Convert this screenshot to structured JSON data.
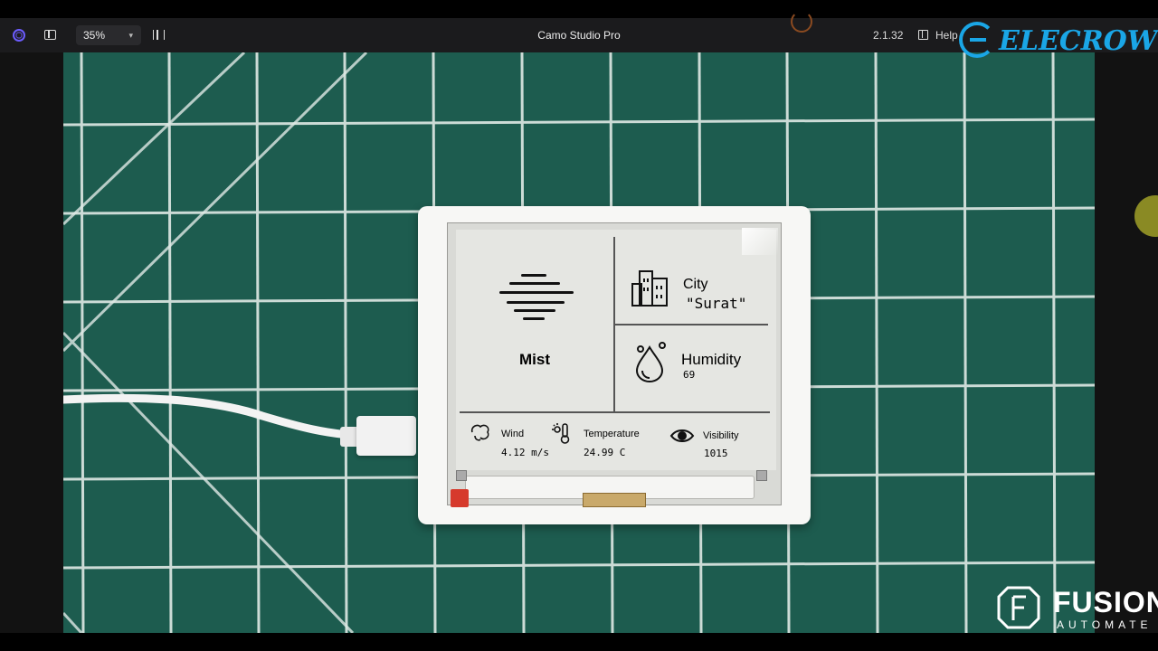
{
  "toolbar": {
    "zoom": "35%",
    "title": "Camo Studio Pro",
    "version": "2.1.32",
    "help": "Help"
  },
  "watermarks": {
    "brand_top": "ELECROW",
    "brand_bottom_name": "FUSION",
    "brand_bottom_sub": "AUTOMATE"
  },
  "epaper": {
    "condition": "Mist",
    "city_label": "City",
    "city_value": "\"Surat\"",
    "humidity_label": "Humidity",
    "humidity_value": "69",
    "wind_label": "Wind",
    "wind_value": "4.12 m/s",
    "temperature_label": "Temperature",
    "temperature_value": "24.99 C",
    "visibility_label": "Visibility",
    "visibility_value": "1015"
  },
  "colors": {
    "toolbar_bg": "#1b1b1d",
    "mat_green": "#1d5c4f",
    "grid_line": "#dfe9e5",
    "accent_purple": "#6c5cff",
    "elecrow_blue": "#1aa6e6",
    "red_button": "#d63a2c"
  },
  "icons": {
    "app": "camo-logo-icon",
    "sidebar": "sidebar-toggle-icon",
    "split": "split-view-icon",
    "help": "help-book-icon",
    "mist": "mist-icon",
    "city": "buildings-icon",
    "humidity": "droplet-icon",
    "wind": "wind-icon",
    "temperature": "thermometer-sun-icon",
    "visibility": "eye-icon"
  }
}
